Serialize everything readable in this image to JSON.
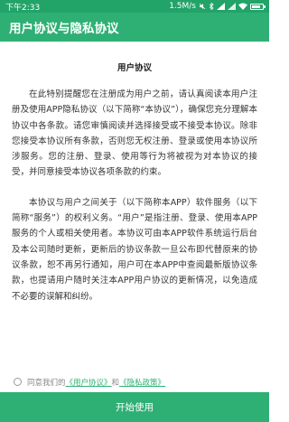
{
  "status_bar": {
    "time": "下午2:33",
    "network_speed": "1.5M/s",
    "icons": [
      "mute-icon",
      "bluetooth-icon",
      "signal-icon",
      "signal-icon",
      "wifi-icon",
      "battery-icon"
    ],
    "battery_level": 0.85
  },
  "app_bar": {
    "title": "用户协议与隐私协议"
  },
  "document": {
    "title": "用户协议",
    "paragraphs": [
      "在此特别提醒您在注册成为用户之前，请认真阅读本用户注册及使用APP隐私协议（以下简称“本协议”），确保您充分理解本协议中各条款。请您审慎阅读并选择接受或不接受本协议。除非您接受本协议所有条款，否则您无权注册、登录或使用本协议所涉服务。您的注册、登录、使用等行为将被视为对本协议的接受，并同意接受本协议各项条款的约束。",
      "本协议与用户之间关于（以下简称本APP）软件服务（以下简称“服务”）的权利义务。“用户”是指注册、登录、使用本APP服务的个人或相关使用者。本协议可由本APP软件系统运行后台及本公司随时更新，更新后的协议条款一旦公布即代替原来的协议条款，恕不再另行通知，用户可在本APP中查阅最新版协议条款，也提请用户随时关注本APP用户协议的更新情况，以免造成不必要的误解和纠纷。"
    ]
  },
  "agreement": {
    "prefix": "同意我们的",
    "user_agreement_link": "《用户协议》",
    "conjunction": "和",
    "privacy_policy_link": "《隐私政策》"
  },
  "start_button": {
    "label": "开始使用"
  }
}
